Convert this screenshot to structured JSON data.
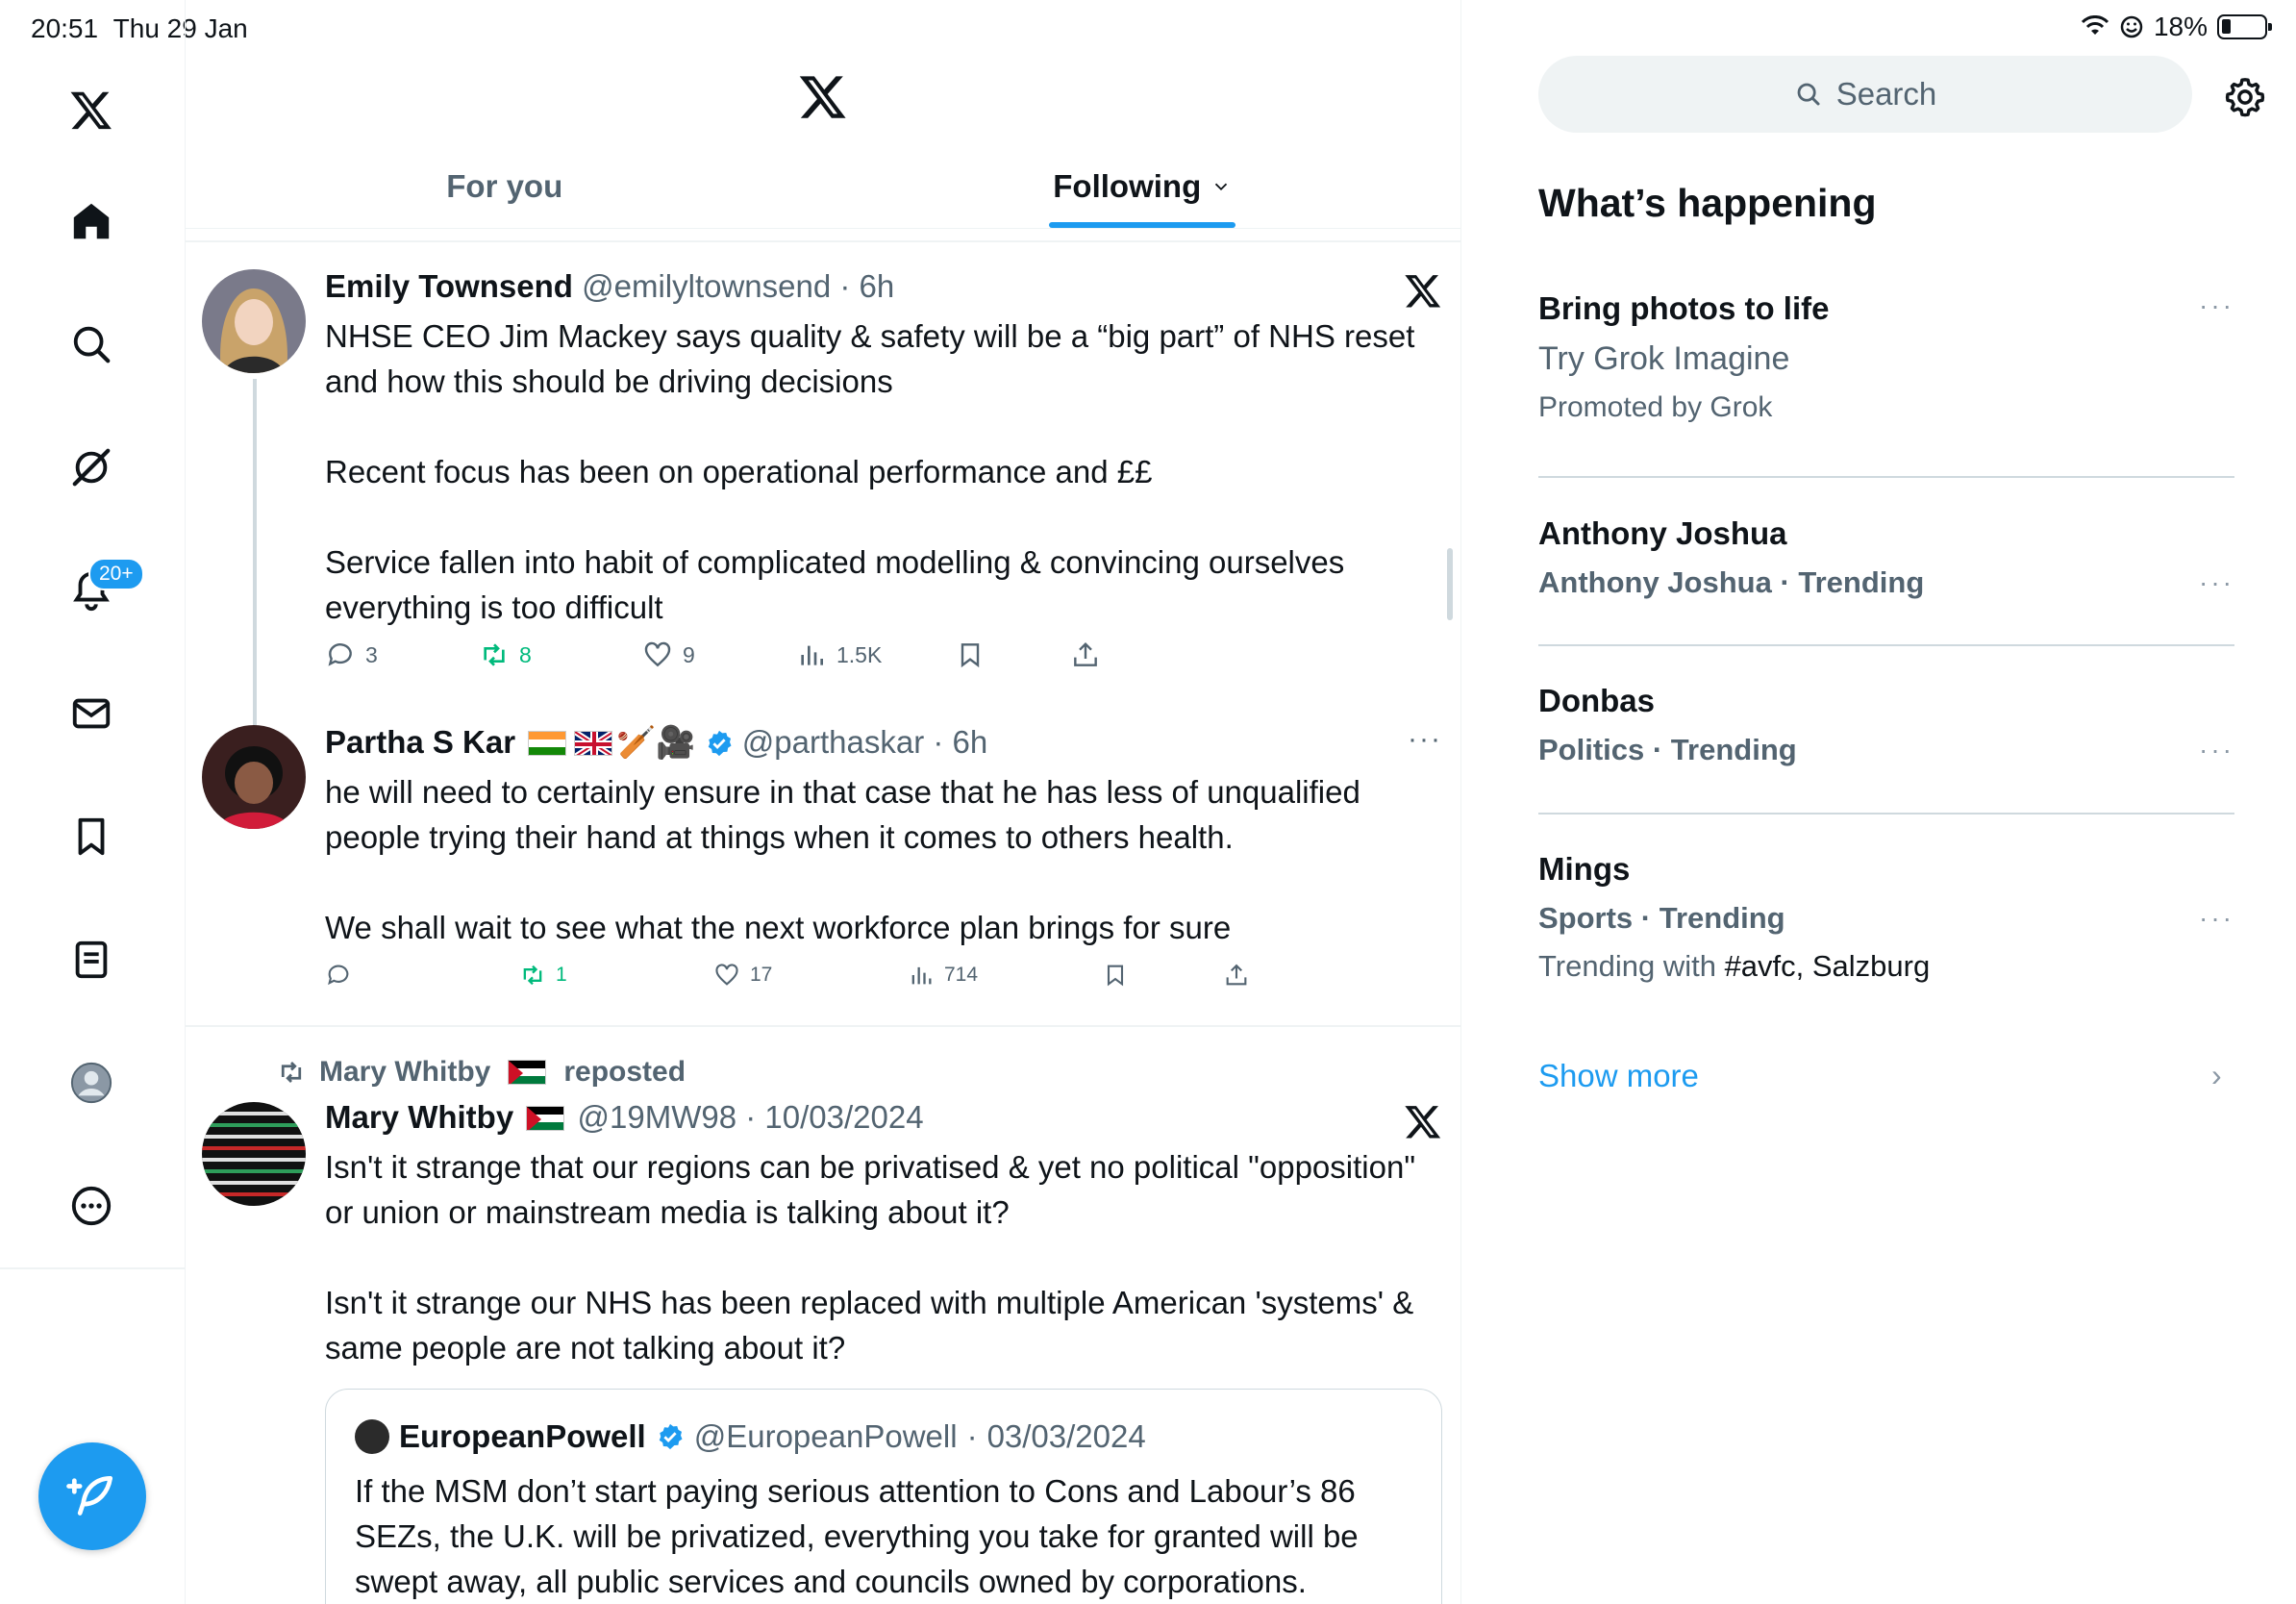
{
  "status_bar": {
    "time": "20:51",
    "date": "Thu 29 Jan",
    "battery": "18%"
  },
  "nav": {
    "notifications_badge": "20+",
    "items": [
      "home",
      "explore",
      "grok",
      "notifications",
      "messages",
      "bookmarks",
      "lists",
      "profile",
      "more"
    ]
  },
  "tabs": [
    {
      "label": "For you"
    },
    {
      "label": "Following"
    }
  ],
  "tweets": [
    {
      "name": "Emily Townsend",
      "handle": "@emilyltownsend",
      "time": "6h",
      "paragraphs": [
        "NHSE CEO Jim Mackey says quality & safety will be a “big part” of NHS reset and how this should be driving decisions",
        "Recent focus has been on operational performance and ££",
        "Service fallen into habit of complicated modelling & convincing ourselves everything is too difficult"
      ],
      "replies": "3",
      "reposts": "8",
      "likes": "9",
      "views": "1.5K"
    },
    {
      "name": "Partha S Kar",
      "emoji_suffix": "🏏🎥",
      "handle": "@parthaskar",
      "time": "6h",
      "paragraphs": [
        "he will need to certainly ensure in that case that he has less of unqualified people trying their hand at things when it comes to others health.",
        "We shall wait to see what the next workforce plan brings for sure"
      ],
      "reposts": "1",
      "likes": "17",
      "views": "714"
    },
    {
      "repost_by": "Mary Whitby",
      "repost_label": "reposted",
      "name": "Mary Whitby",
      "handle": "@19MW98",
      "time": "10/03/2024",
      "paragraphs": [
        "Isn't it strange that our regions can be privatised & yet no political \"opposition\" or union or mainstream media is talking about it?",
        "Isn't it strange our NHS has been replaced with multiple American 'systems' & same people are not talking about it?"
      ],
      "quote": {
        "name": "EuropeanPowell",
        "handle": "@EuropeanPowell",
        "time": "03/03/2024",
        "text": "If the MSM don’t start paying serious attention to Cons and Labour’s 86 SEZs, the U.K. will be privatized, everything you take for granted will be swept away, all public services and councils owned by corporations."
      }
    }
  ],
  "right": {
    "search_placeholder": "Search",
    "title": "What’s happening",
    "trends": [
      {
        "title": "Bring photos to life",
        "sub": "Try Grok Imagine",
        "extra": "Promoted by Grok"
      },
      {
        "title": "Anthony Joshua",
        "sub": "Anthony Joshua · Trending"
      },
      {
        "title": "Donbas",
        "sub": "Politics · Trending"
      },
      {
        "title": "Mings",
        "sub": "Sports · Trending",
        "extra_prefix": "Trending with ",
        "extra_bold": "#avfc, Salzburg"
      }
    ],
    "show_more": "Show more"
  },
  "colors": {
    "accent": "#1d9bf0",
    "repost_green": "#00ba7c",
    "text_secondary": "#536471"
  }
}
